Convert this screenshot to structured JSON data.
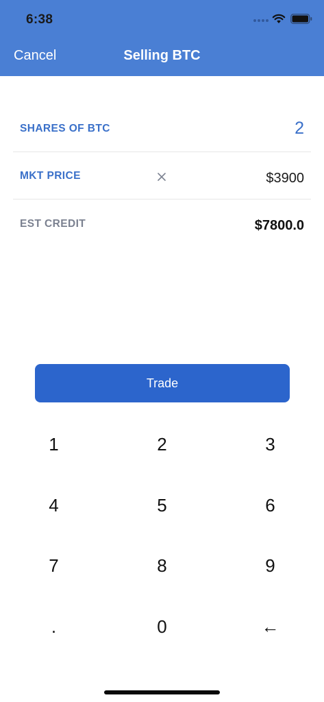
{
  "status_bar": {
    "time": "6:38",
    "icons": [
      "signal-dots-icon",
      "wifi-icon",
      "battery-icon"
    ]
  },
  "nav": {
    "cancel_label": "Cancel",
    "title": "Selling BTC"
  },
  "colors": {
    "header_bg": "#4a7fd4",
    "accent_blue": "#3a70c9",
    "button_blue": "#2c65cc",
    "muted_gray": "#7b8190"
  },
  "form": {
    "shares": {
      "label": "SHARES OF BTC",
      "value": "2"
    },
    "market_price": {
      "label": "MKT PRICE",
      "operator_icon": "times-icon",
      "value": "$3900"
    },
    "est_credit": {
      "label": "EST CREDIT",
      "value": "$7800.0"
    }
  },
  "trade_button": {
    "label": "Trade"
  },
  "keypad": {
    "keys": [
      "1",
      "2",
      "3",
      "4",
      "5",
      "6",
      "7",
      "8",
      "9",
      ".",
      "0",
      "←"
    ]
  }
}
